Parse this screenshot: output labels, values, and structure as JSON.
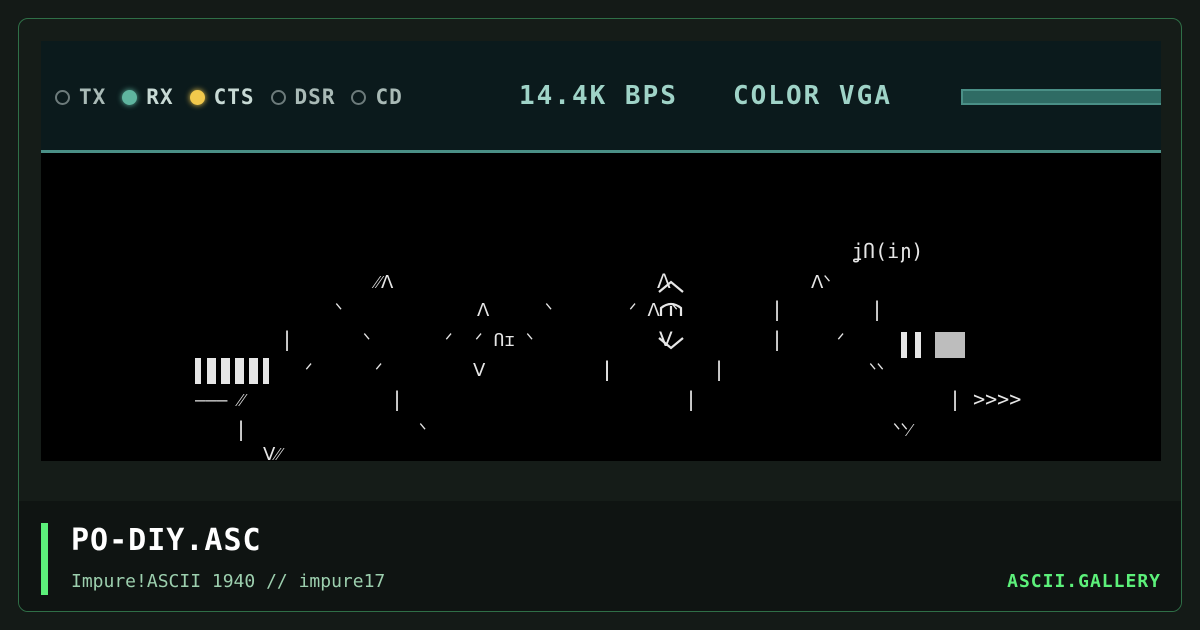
{
  "status_bar": {
    "indicators": [
      {
        "label": "TX",
        "state": "off"
      },
      {
        "label": "RX",
        "state": "on",
        "color": "#5fb59f"
      },
      {
        "label": "CTS",
        "state": "on",
        "color": "#f2c94c"
      },
      {
        "label": "DSR",
        "state": "off"
      },
      {
        "label": "CD",
        "state": "off"
      }
    ],
    "baud": "14.4K BPS",
    "display_mode": "COLOR VGA",
    "signal_level": 1.0
  },
  "art": {
    "lines": [
      {
        "text": "ʝՈ(iɲ)"
      },
      {
        "text": "⁄⁄ᐱ"
      },
      {
        "text": "ᐱ"
      },
      {
        "text": "ᐱᐠ"
      },
      {
        "text": "ᐠ"
      },
      {
        "text": "ᐱ"
      },
      {
        "text": "ᐠ"
      },
      {
        "text": "ᐟ ᐱ ᐠ"
      },
      {
        "text": "|"
      },
      {
        "text": "|"
      },
      {
        "text": "|"
      },
      {
        "text": "ᐠ"
      },
      {
        "text": "ᐟ"
      },
      {
        "text": "ᐟ Ոɪ ᐠ"
      },
      {
        "text": "ᐟ"
      },
      {
        "text": "ᐯ"
      },
      {
        "text": "|"
      },
      {
        "text": "ᐟ"
      },
      {
        "text": "|"
      },
      {
        "text": "ᐟ"
      },
      {
        "text": "ᐯ"
      },
      {
        "text": "|"
      },
      {
        "text": "|"
      },
      {
        "text": "ᐠᐠ"
      },
      {
        "text": "——— ⁄⁄"
      },
      {
        "text": "|"
      },
      {
        "text": "|"
      },
      {
        "text": "| >>>>"
      },
      {
        "text": "|"
      },
      {
        "text": "ᐠ"
      },
      {
        "text": "ᐠᐠ⁄"
      },
      {
        "text": "ᐯ⁄⁄"
      }
    ]
  },
  "footer": {
    "title": "PO-DIY.ASC",
    "subtitle": "Impure!ASCII 1940 // impure17",
    "brand": "ASCII.GALLERY"
  },
  "colors": {
    "accent": "#5cf07a",
    "screen_bg": "#000000",
    "status_bg": "#0b1a1c",
    "status_text": "#9fd3c7"
  }
}
